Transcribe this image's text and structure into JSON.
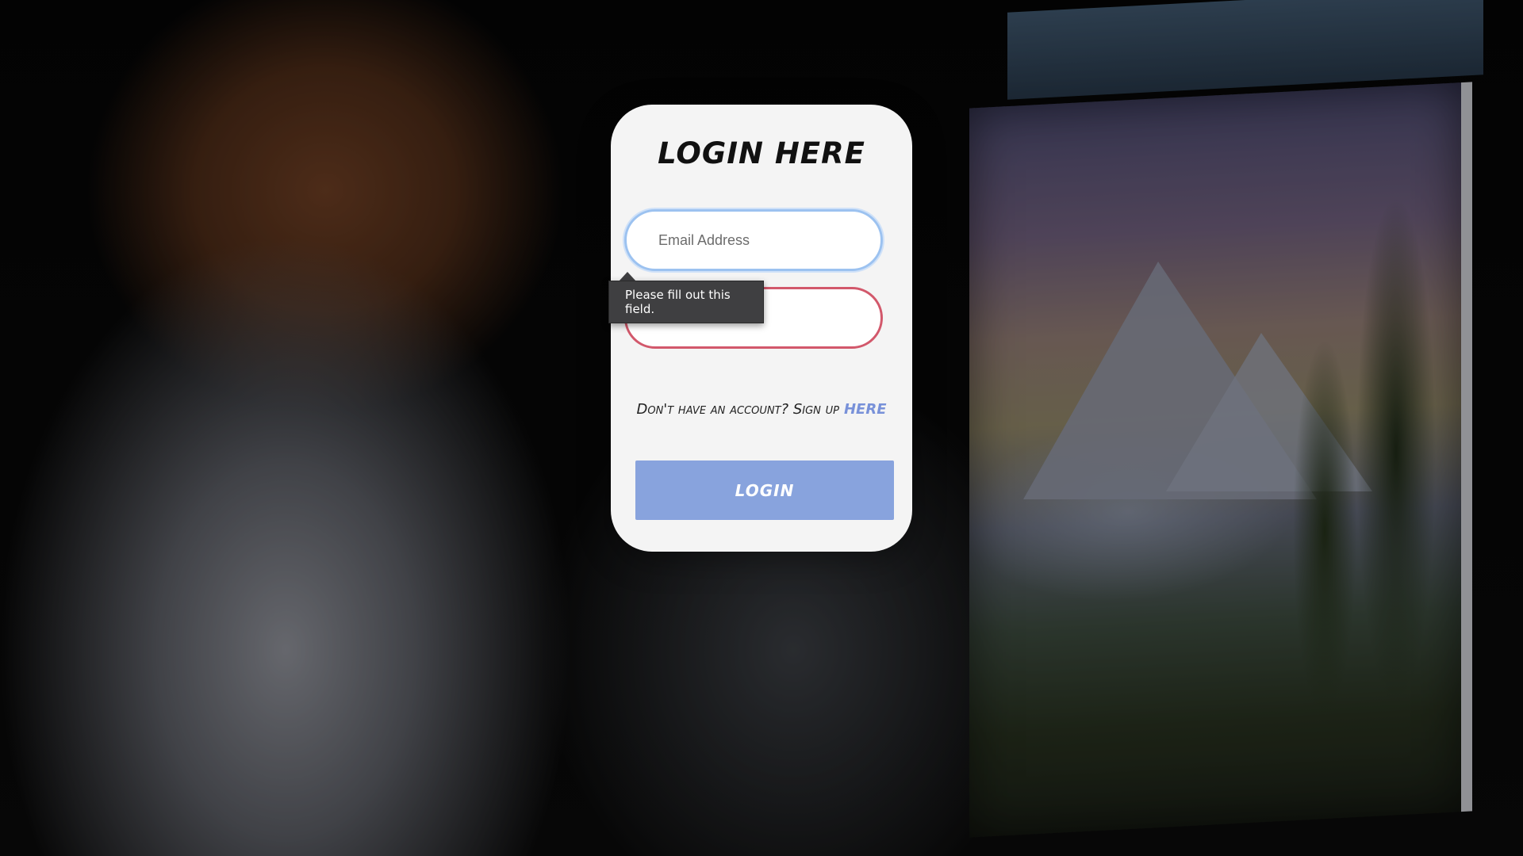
{
  "login_card": {
    "title": "Login Here",
    "email_field": {
      "placeholder": "Email Address",
      "value": ""
    },
    "password_field": {
      "value": ""
    },
    "validation_tooltip": "Please fill out this field.",
    "signup_prompt": "Don't have an account? Sign up",
    "signup_link": "Here",
    "login_button": "Login"
  },
  "colors": {
    "card_background": "#f4f4f4",
    "accent": "#88a3dd",
    "link": "#7891d9",
    "focus_border": "#9cc2f0",
    "invalid_border": "#d2586b",
    "tooltip_background": "#3f3f41"
  }
}
